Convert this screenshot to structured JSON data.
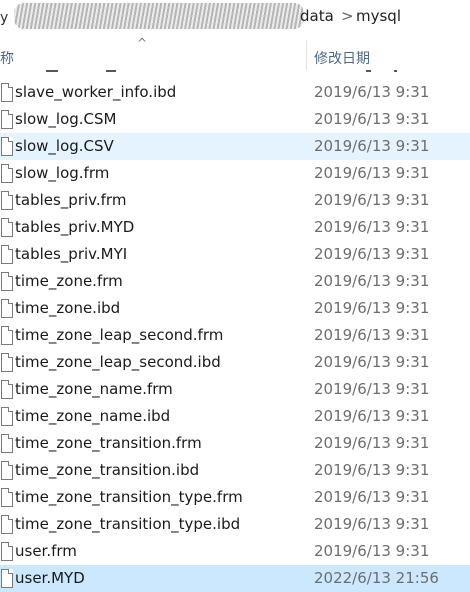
{
  "breadcrumb": {
    "leading": "y",
    "seg1": "data",
    "seg2": "mysql",
    "separator": ">"
  },
  "header": {
    "name_col": "称",
    "date_col": "修改日期",
    "sort_indicator": "^"
  },
  "files": [
    {
      "name": "slave_worker_info.ibd",
      "date": "2019/6/13 9:31"
    },
    {
      "name": "slow_log.CSM",
      "date": "2019/6/13 9:31"
    },
    {
      "name": "slow_log.CSV",
      "date": "2019/6/13 9:31",
      "state": "hover"
    },
    {
      "name": "slow_log.frm",
      "date": "2019/6/13 9:31"
    },
    {
      "name": "tables_priv.frm",
      "date": "2019/6/13 9:31"
    },
    {
      "name": "tables_priv.MYD",
      "date": "2019/6/13 9:31"
    },
    {
      "name": "tables_priv.MYI",
      "date": "2019/6/13 9:31"
    },
    {
      "name": "time_zone.frm",
      "date": "2019/6/13 9:31"
    },
    {
      "name": "time_zone.ibd",
      "date": "2019/6/13 9:31"
    },
    {
      "name": "time_zone_leap_second.frm",
      "date": "2019/6/13 9:31"
    },
    {
      "name": "time_zone_leap_second.ibd",
      "date": "2019/6/13 9:31"
    },
    {
      "name": "time_zone_name.frm",
      "date": "2019/6/13 9:31"
    },
    {
      "name": "time_zone_name.ibd",
      "date": "2019/6/13 9:31"
    },
    {
      "name": "time_zone_transition.frm",
      "date": "2019/6/13 9:31"
    },
    {
      "name": "time_zone_transition.ibd",
      "date": "2019/6/13 9:31"
    },
    {
      "name": "time_zone_transition_type.frm",
      "date": "2019/6/13 9:31"
    },
    {
      "name": "time_zone_transition_type.ibd",
      "date": "2019/6/13 9:31"
    },
    {
      "name": "user.frm",
      "date": "2019/6/13 9:31"
    },
    {
      "name": "user.MYD",
      "date": "2022/6/13 21:56",
      "state": "selected"
    }
  ]
}
